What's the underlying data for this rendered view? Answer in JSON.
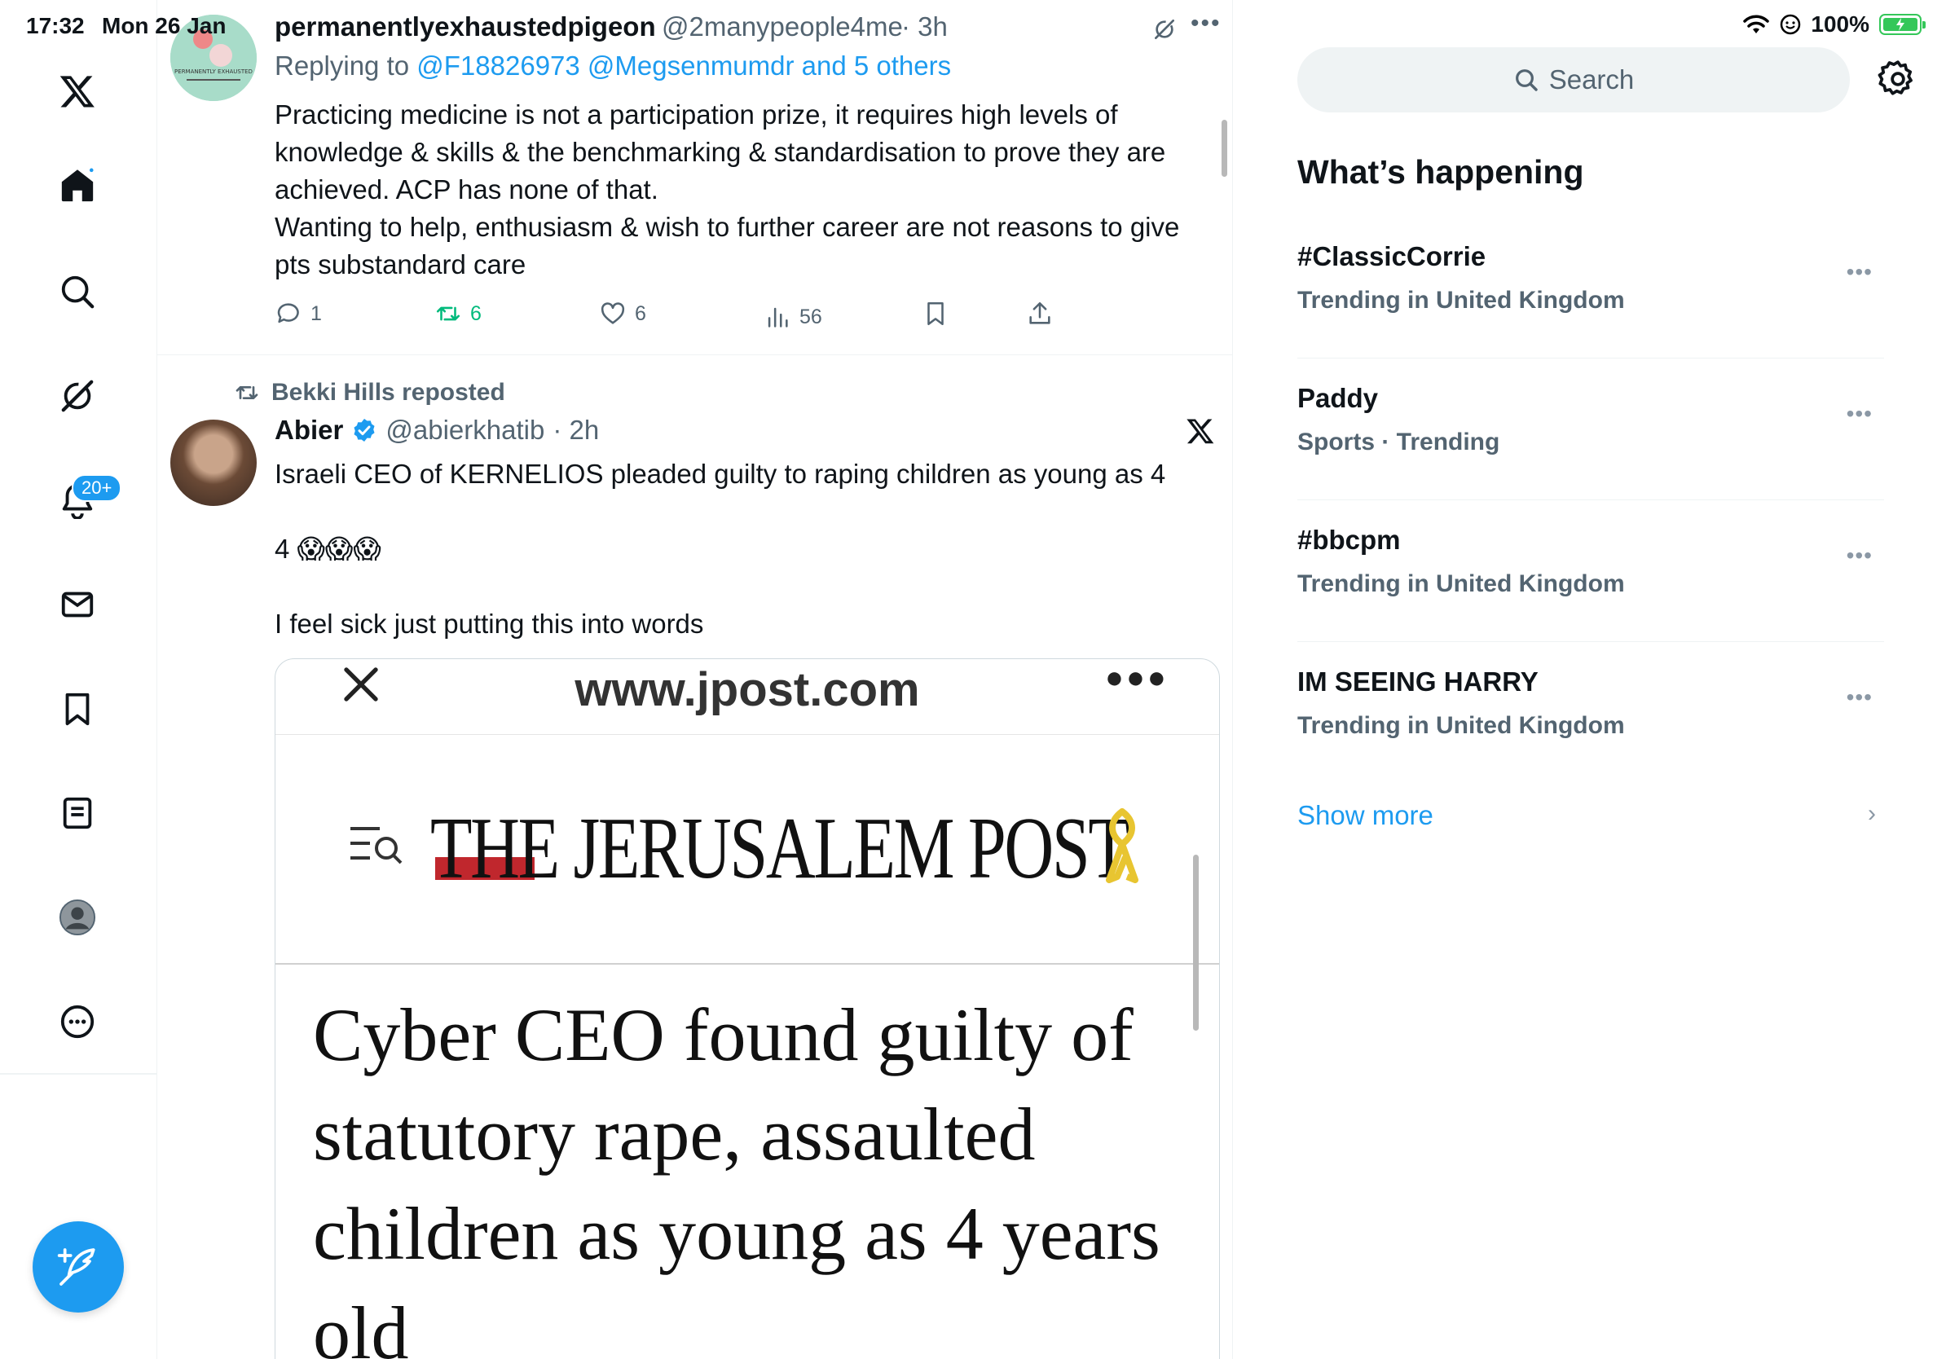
{
  "statusbar": {
    "time": "17:32",
    "date": "Mon 26 Jan",
    "battery": "100%"
  },
  "nav": {
    "items": [
      "x-logo",
      "home",
      "explore",
      "grok",
      "notifications",
      "messages",
      "bookmarks",
      "lists",
      "profile",
      "more"
    ],
    "notif_badge": "20+"
  },
  "tweet1": {
    "name": "permanentlyexhaustedpigeon",
    "handle": "@2manypeople4me",
    "time": "· 3h",
    "replying_prefix": "Replying to ",
    "replying_links": "@F18826973 @Megsenmumdr and 5 others",
    "body_lines": [
      "Practicing medicine is not a participation prize, it requires high levels of",
      "knowledge & skills & the benchmarking & standardisation to prove they are",
      "achieved. ACP has none of that.",
      "Wanting to help, enthusiasm & wish to further career are not reasons to give",
      "pts substandard care"
    ],
    "stats": {
      "replies": "1",
      "reposts": "6",
      "likes": "6",
      "views": "56"
    }
  },
  "tweet2": {
    "repost_by": "Bekki Hills reposted",
    "name": "Abier",
    "handle": "@abierkhatib",
    "time": "· 2h",
    "line1": "Israeli CEO of KERNELIOS pleaded guilty to raping children as young as  4",
    "line2": "4 😱😱😱",
    "line3": "I feel sick just putting this into words",
    "media": {
      "url": "www.jpost.com",
      "logo": "THE JERUSALEM POST",
      "headline": "Cyber CEO found guilty of statutory rape, assaulted children as young as 4 years old"
    }
  },
  "right": {
    "search_placeholder": "Search",
    "section_title": "What’s happening",
    "trends": [
      {
        "title": "#ClassicCorrie",
        "sub": "Trending in United Kingdom"
      },
      {
        "title": "Paddy",
        "sub": "Sports · Trending"
      },
      {
        "title": "#bbcpm",
        "sub": "Trending in United Kingdom"
      },
      {
        "title": "IM SEEING HARRY",
        "sub": "Trending in United Kingdom"
      }
    ],
    "show_more": "Show more"
  }
}
